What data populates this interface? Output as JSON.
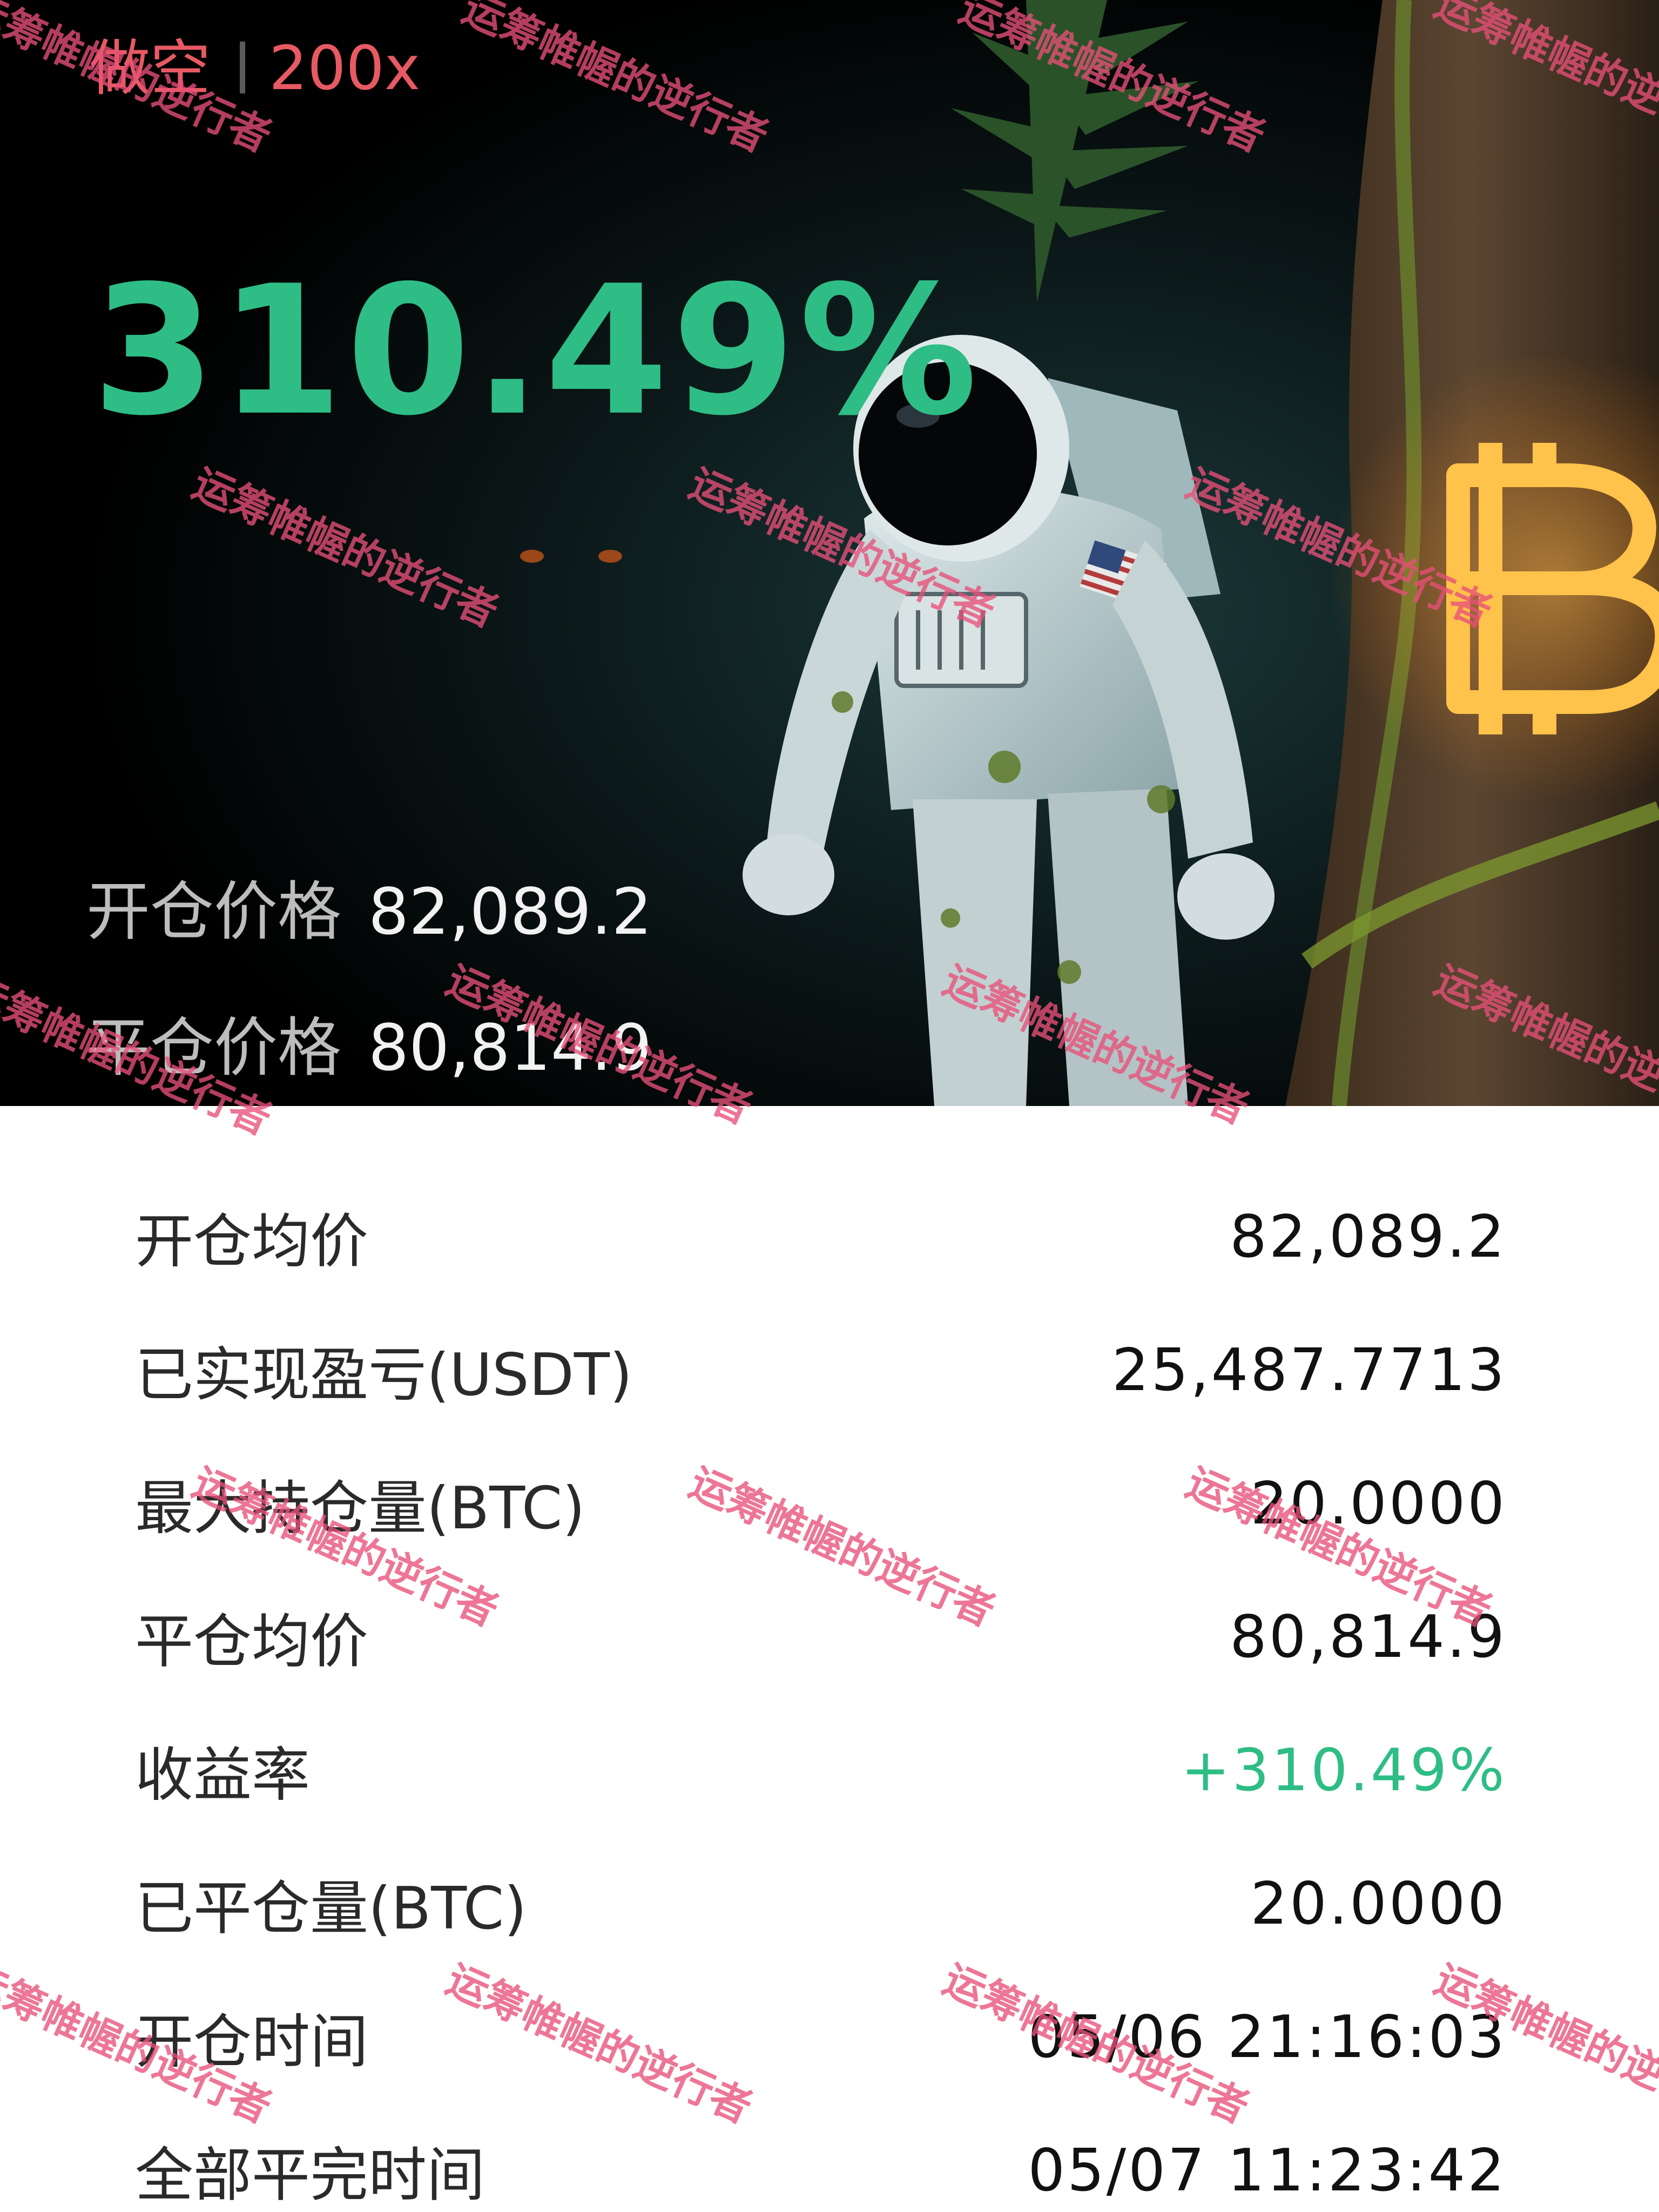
{
  "theme": {
    "short_color": "#e85a63",
    "profit_color": "#2ebd85",
    "watermark_color": "#e85078"
  },
  "header": {
    "direction": "做空",
    "leverage": "200x"
  },
  "summary": {
    "pnl_percent": "310.49%",
    "open_price_label": "开仓价格",
    "open_price": "82,089.2",
    "close_price_label": "平仓价格",
    "close_price": "80,814.9"
  },
  "details": [
    {
      "label": "开仓均价",
      "value": "82,089.2"
    },
    {
      "label": "已实现盈亏(USDT)",
      "value": "25,487.7713"
    },
    {
      "label": "最大持仓量(BTC)",
      "value": "20.0000"
    },
    {
      "label": "平仓均价",
      "value": "80,814.9"
    },
    {
      "label": "收益率",
      "value": "+310.49%"
    },
    {
      "label": "已平仓量(BTC)",
      "value": "20.0000"
    },
    {
      "label": "开仓时间",
      "value": "05/06 21:16:03"
    },
    {
      "label": "全部平完时间",
      "value": "05/07 11:23:42"
    }
  ],
  "watermark": {
    "text": "运筹帷幄的逆行者"
  }
}
